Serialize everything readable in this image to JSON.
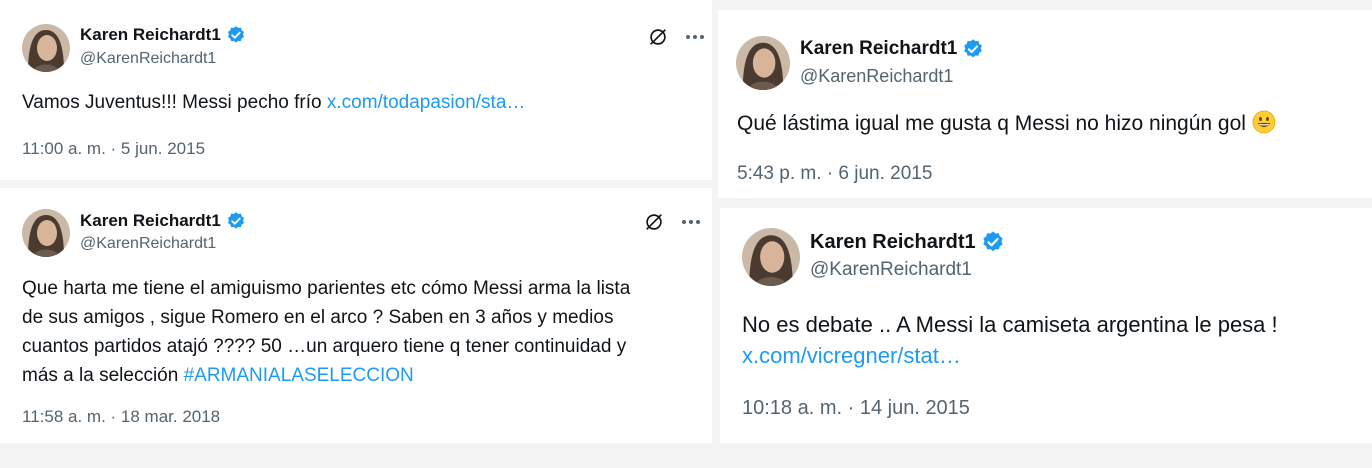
{
  "author": {
    "name": "Karen Reichardt1",
    "handle": "@KarenReichardt1",
    "verified_color": "#1d9bf0"
  },
  "colors": {
    "link": "#1d9bf0",
    "secondary_text": "#536471",
    "primary_text": "#0f1419"
  },
  "icons": [
    "grok-icon",
    "more-icon",
    "verified-badge-icon",
    "grinning-emoji"
  ],
  "tweets": [
    {
      "text": "Vamos Juventus!!! Messi pecho frío ",
      "link": "x.com/todapasion/sta…",
      "timestamp": "11:00 a. m. · 5 jun. 2015"
    },
    {
      "lines": [
        "Que harta me tiene el amiguismo parientes etc  cómo Messi arma la lista",
        "de sus amigos  , sigue Romero en el arco ? Saben en 3 años y medios",
        "cuantos partidos atajó ???? 50 …un arquero tiene q tener continuidad y",
        "más a la selección "
      ],
      "hashtag": "#ARMANIALASELECCION",
      "timestamp": "11:58 a. m. · 18 mar. 2018"
    },
    {
      "text": "Qué lástima igual me gusta q Messi no hizo ningún gol ",
      "timestamp": "5:43 p. m. · 6 jun. 2015"
    },
    {
      "text": "No es debate .. A Messi la camiseta argentina le pesa !",
      "link": "x.com/vicregner/stat…",
      "timestamp": "10:18 a. m. · 14 jun. 2015"
    }
  ]
}
